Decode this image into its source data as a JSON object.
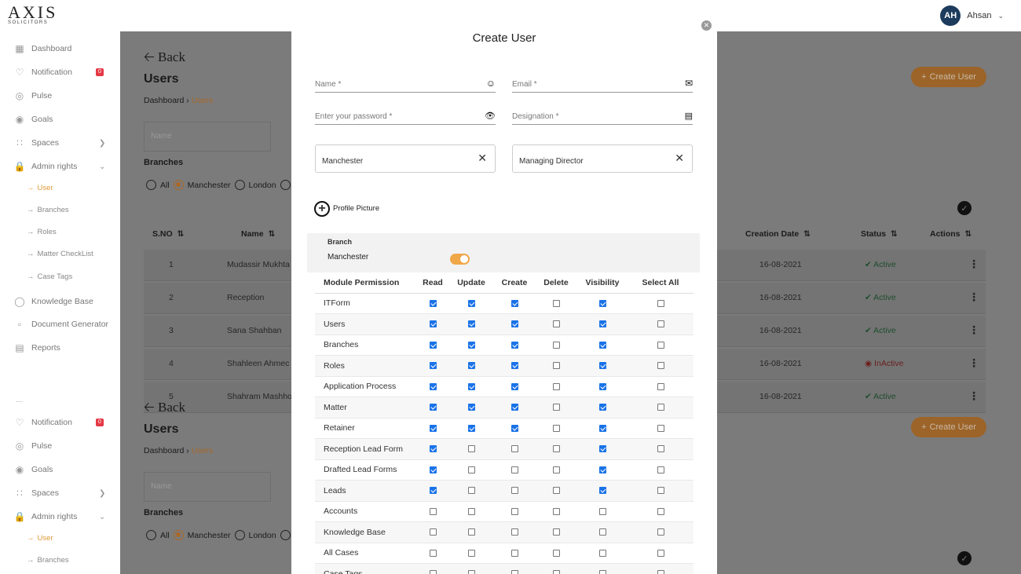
{
  "topbar": {
    "logo_main": "AXIS",
    "logo_sub": "SOLICITORS",
    "avatar": "AH",
    "user_name": "Ahsan"
  },
  "sidebar": {
    "items": [
      {
        "label": "Dashboard",
        "icon": "grid-icon"
      },
      {
        "label": "Notification",
        "icon": "bell-icon",
        "badge": "0"
      },
      {
        "label": "Pulse",
        "icon": "pulse-icon"
      },
      {
        "label": "Goals",
        "icon": "target-icon"
      },
      {
        "label": "Spaces",
        "icon": "dots-icon"
      },
      {
        "label": "Admin rights",
        "icon": "lock-icon"
      },
      {
        "label": "User",
        "sub": true,
        "active": true
      },
      {
        "label": "Branches",
        "sub": true
      },
      {
        "label": "Roles",
        "sub": true
      },
      {
        "label": "Matter CheckList",
        "sub": true
      },
      {
        "label": "Case Tags",
        "sub": true
      },
      {
        "label": "Knowledge Base",
        "icon": "bulb-icon"
      },
      {
        "label": "Document Generator",
        "icon": "doc-icon"
      },
      {
        "label": "Reports",
        "icon": "report-icon"
      }
    ],
    "items_lower": [
      {
        "label": "Notification",
        "badge": "0"
      },
      {
        "label": "Pulse"
      },
      {
        "label": "Goals"
      },
      {
        "label": "Spaces"
      },
      {
        "label": "Admin rights"
      },
      {
        "label": "User",
        "active": true
      },
      {
        "label": "Branches"
      }
    ],
    "separator": "---"
  },
  "background": {
    "back_label": "Back",
    "title": "Users",
    "crumb_home": "Dashboard",
    "crumb_sep": "›",
    "crumb_current": "Users",
    "name_placeholder": "Name",
    "branches_label": "Branches",
    "radio_all": "All",
    "radio_manchester": "Manchester",
    "radio_london": "London",
    "create_user_label": "Create User",
    "columns": {
      "sno": "S.NO",
      "name": "Name",
      "creation_date": "Creation Date",
      "status": "Status",
      "actions": "Actions"
    },
    "rows": [
      {
        "sno": "1",
        "name": "Mudassir Mukhta",
        "date": "16-08-2021",
        "status": "Active"
      },
      {
        "sno": "2",
        "name": "Reception",
        "date": "16-08-2021",
        "status": "Active"
      },
      {
        "sno": "3",
        "name": "Sana Shahban",
        "date": "16-08-2021",
        "status": "Active"
      },
      {
        "sno": "4",
        "name": "Shahleen Ahmec",
        "date": "16-08-2021",
        "status": "InActive"
      },
      {
        "sno": "5",
        "name": "Shahram Mashhoo",
        "date": "16-08-2021",
        "status": "Active"
      }
    ]
  },
  "modal": {
    "title": "Create User",
    "name_label": "Name *",
    "email_label": "Email *",
    "password_label": "Enter your password *",
    "designation_label": "Designation *",
    "branch_value": "Manchester",
    "role_value": "Managing Director",
    "profile_picture_label": "Profile Picture",
    "branch_section_label": "Branch",
    "branch_toggle_label": "Manchester",
    "branch_toggle_on": true,
    "permission_headers": [
      "Module Permission",
      "Read",
      "Update",
      "Create",
      "Delete",
      "Visibility",
      "Select All"
    ],
    "permissions": [
      {
        "module": "ITForm",
        "flags": [
          1,
          1,
          1,
          0,
          1,
          0
        ]
      },
      {
        "module": "Users",
        "flags": [
          1,
          1,
          1,
          0,
          1,
          0
        ]
      },
      {
        "module": "Branches",
        "flags": [
          1,
          1,
          1,
          0,
          1,
          0
        ]
      },
      {
        "module": "Roles",
        "flags": [
          1,
          1,
          1,
          0,
          1,
          0
        ]
      },
      {
        "module": "Application Process",
        "flags": [
          1,
          1,
          1,
          0,
          1,
          0
        ]
      },
      {
        "module": "Matter",
        "flags": [
          1,
          1,
          1,
          0,
          1,
          0
        ]
      },
      {
        "module": "Retainer",
        "flags": [
          1,
          1,
          1,
          0,
          1,
          0
        ]
      },
      {
        "module": "Reception Lead Form",
        "flags": [
          1,
          0,
          0,
          0,
          1,
          0
        ]
      },
      {
        "module": "Drafted Lead Forms",
        "flags": [
          1,
          0,
          0,
          0,
          1,
          0
        ]
      },
      {
        "module": "Leads",
        "flags": [
          1,
          0,
          0,
          0,
          1,
          0
        ]
      },
      {
        "module": "Accounts",
        "flags": [
          0,
          0,
          0,
          0,
          0,
          0
        ]
      },
      {
        "module": "Knowledge Base",
        "flags": [
          0,
          0,
          0,
          0,
          0,
          0
        ]
      },
      {
        "module": "All Cases",
        "flags": [
          0,
          0,
          0,
          0,
          0,
          0
        ]
      },
      {
        "module": "Case Tags",
        "flags": [
          0,
          0,
          0,
          0,
          0,
          0
        ]
      }
    ]
  }
}
